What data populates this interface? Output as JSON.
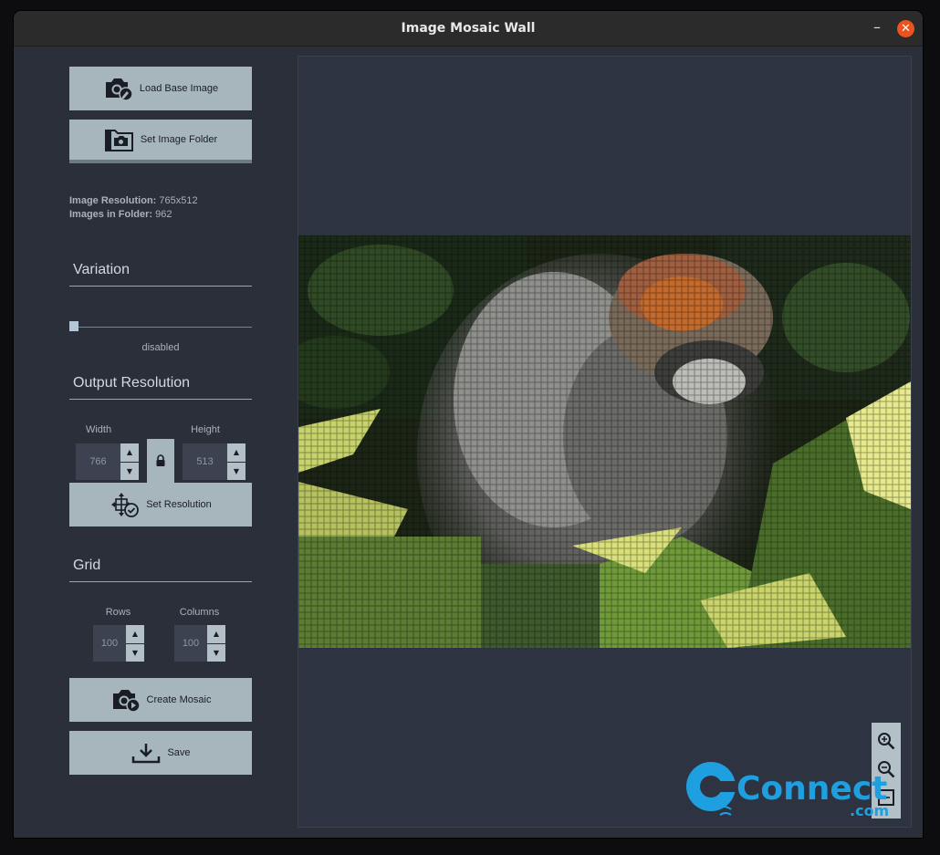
{
  "window": {
    "title": "Image Mosaic Wall",
    "minimize": "–",
    "close": "✕"
  },
  "buttons": {
    "load_base_image": "Load Base Image",
    "set_image_folder": "Set Image Folder",
    "set_resolution": "Set Resolution",
    "create_mosaic": "Create Mosaic",
    "save": "Save"
  },
  "info": {
    "resolution_label": "Image Resolution:",
    "resolution_value": "765x512",
    "folder_label": "Images in Folder:",
    "folder_value": "962"
  },
  "variation": {
    "title": "Variation",
    "status": "disabled",
    "value": 0
  },
  "output_resolution": {
    "title": "Output Resolution",
    "width_label": "Width",
    "width_value": "766",
    "height_label": "Height",
    "height_value": "513"
  },
  "grid": {
    "title": "Grid",
    "rows_label": "Rows",
    "rows_value": "100",
    "columns_label": "Columns",
    "columns_value": "100"
  },
  "icons": {
    "camera": "camera-icon",
    "folder": "folder-camera-icon",
    "lock": "lock-icon",
    "resize": "resize-check-icon",
    "create": "camera-play-icon",
    "save": "download-icon",
    "zoom_in": "zoom-in-icon",
    "zoom_out": "zoom-out-icon",
    "zoom_fit": "zoom-fit-icon"
  },
  "watermark": {
    "main": "Connect",
    "sub": ".com"
  },
  "colors": {
    "button_bg": "#a7b6bd",
    "close": "#e95420",
    "canvas_bg": "#2e3341",
    "panel_bg": "#2a2f3a"
  }
}
